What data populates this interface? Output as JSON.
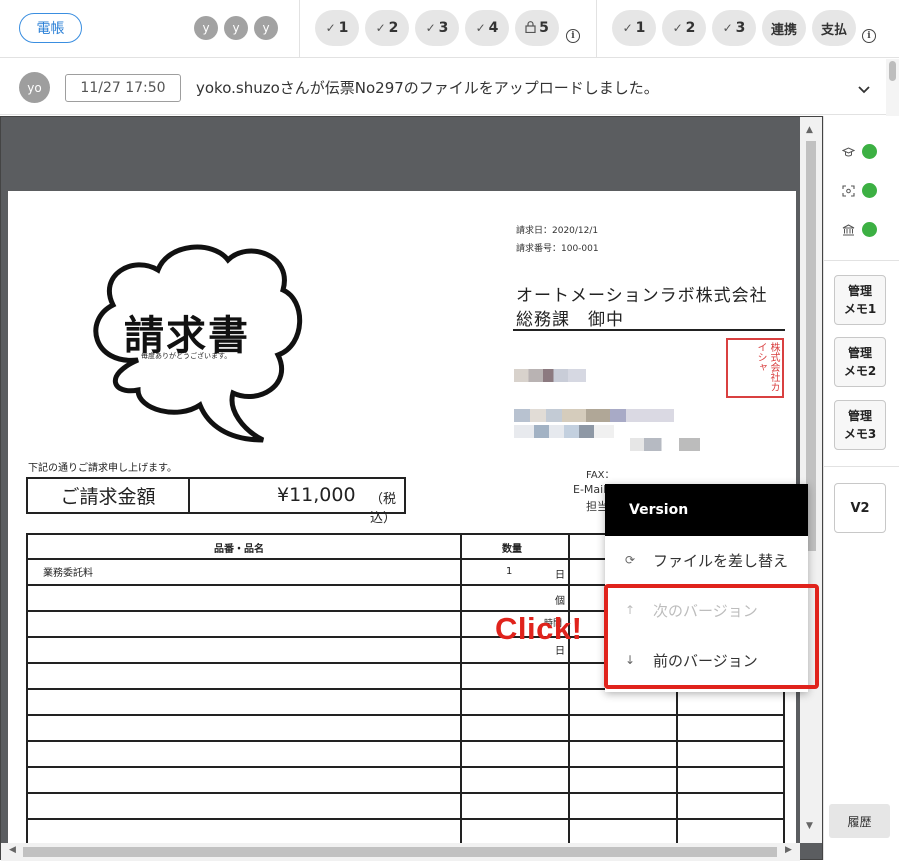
{
  "topbar": {
    "ledger_label": "電帳",
    "users": [
      "y",
      "y",
      "y"
    ],
    "approvals_group1": [
      {
        "icon": "check-icon",
        "label": "1"
      },
      {
        "icon": "check-icon",
        "label": "2"
      },
      {
        "icon": "check-icon",
        "label": "3"
      },
      {
        "icon": "check-icon",
        "label": "4"
      },
      {
        "icon": "lock-icon",
        "label": "5"
      }
    ],
    "approvals_group2": [
      {
        "icon": "check-icon",
        "label": "1"
      },
      {
        "icon": "check-icon",
        "label": "2"
      },
      {
        "icon": "check-icon",
        "label": "3"
      },
      {
        "icon": "",
        "label": "連携"
      },
      {
        "icon": "",
        "label": "支払"
      }
    ],
    "info_glyph": "i"
  },
  "activity": {
    "avatar": "yo",
    "time": "11/27 17:50",
    "message": "yoko.shuzoさんが伝票No297のファイルをアップロードしました。"
  },
  "document": {
    "invoice_date": "請求日：2020/12/1",
    "invoice_number": "請求番号：100-001",
    "recipient_company": "オートメーションラボ株式会社",
    "recipient_dept": "総務課　御中",
    "stamp_text": "株式会社カイシャ",
    "bubble_title": "請求書",
    "bubble_subtitle": "毎度ありがとうございます。",
    "intro_text": "下記の通りご請求申し上げます。",
    "amount_label": "ご請求金額",
    "amount_value": "¥11,000",
    "amount_tax": "（税込）",
    "fax_label": "FAX：",
    "email_label": "E-Mail：",
    "tanto_label": "担当",
    "table": {
      "headers": [
        "品番・品名",
        "数量"
      ],
      "row1": {
        "item": "業務委託料",
        "qty": "1",
        "unit": "日"
      },
      "fragments": [
        "個",
        "時間",
        "日"
      ]
    },
    "click_label": "Click!"
  },
  "version_menu": {
    "title": "Version",
    "items": [
      {
        "icon": "refresh-icon",
        "label": "ファイルを差し替え",
        "enabled": true
      },
      {
        "icon": "arrow-up-icon",
        "label": "次のバージョン",
        "enabled": false
      },
      {
        "icon": "arrow-down-icon",
        "label": "前のバージョン",
        "enabled": true
      }
    ]
  },
  "sidebar": {
    "statuses": [
      {
        "icon": "graduation-cap-icon",
        "color": "#3cb043"
      },
      {
        "icon": "scan-icon",
        "color": "#3cb043"
      },
      {
        "icon": "bank-icon",
        "color": "#3cb043"
      }
    ],
    "memo1_line1": "管理",
    "memo1_line2": "メモ1",
    "memo2_line1": "管理",
    "memo2_line2": "メモ2",
    "memo3_line1": "管理",
    "memo3_line2": "メモ3",
    "version_label": "V2",
    "history_label": "履歴"
  },
  "colors": {
    "accent_blue": "#2a7fd6",
    "highlight_red": "#e0231c",
    "status_green": "#3cb043",
    "viewer_bg": "#5b5d60"
  }
}
